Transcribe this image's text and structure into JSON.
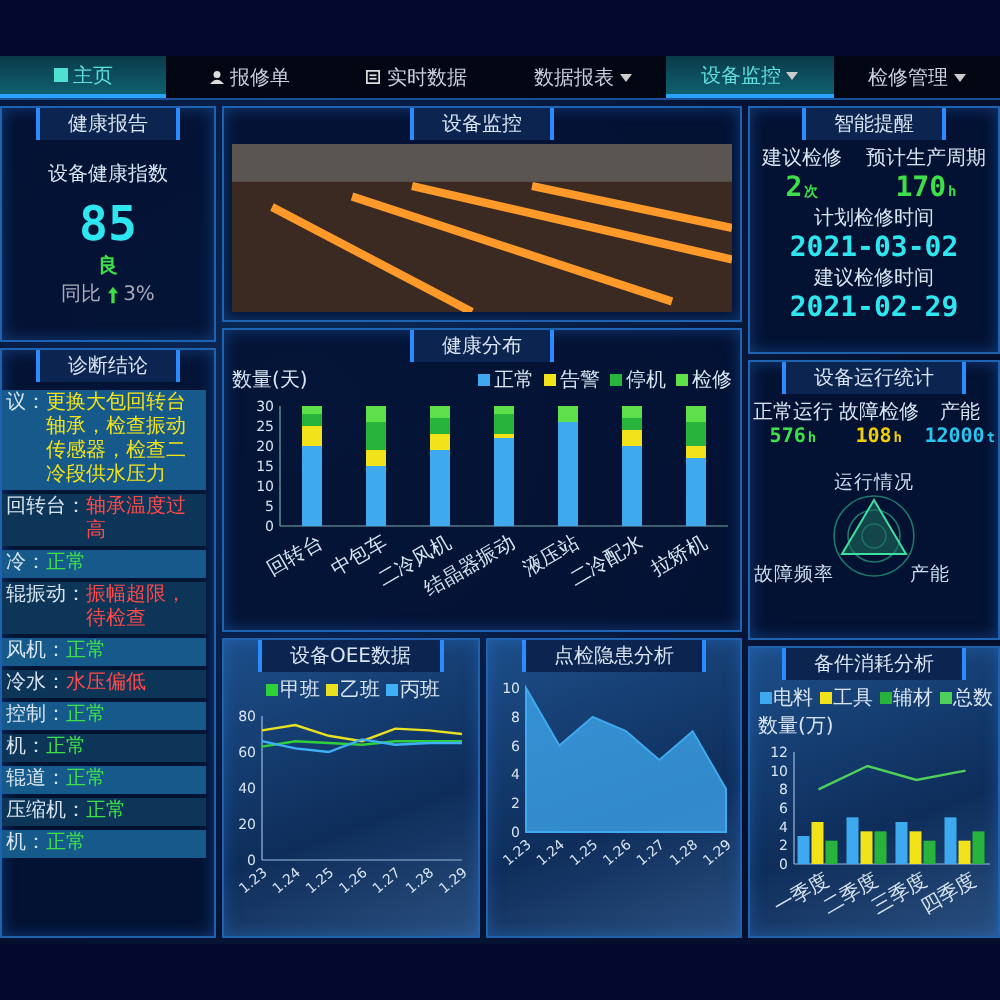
{
  "nav": {
    "tabs": [
      {
        "label": "主页",
        "kind": "grid",
        "selected": true
      },
      {
        "label": "报修单",
        "kind": "user",
        "selected": false
      },
      {
        "label": "实时数据",
        "kind": "doc",
        "selected": false
      },
      {
        "label": "数据报表",
        "kind": "dropdown",
        "selected": false
      },
      {
        "label": "设备监控",
        "kind": "dropdown",
        "selected": true
      },
      {
        "label": "检修管理",
        "kind": "dropdown",
        "selected": false
      }
    ]
  },
  "health_report": {
    "title": "健康报告",
    "index_label": "设备健康指数",
    "index_value": "85",
    "grade": "良",
    "yoy_label": "同比",
    "yoy_value": "3%"
  },
  "diagnosis": {
    "title": "诊断结论",
    "items": [
      {
        "label": "议：",
        "value": "更换大包回转台轴承，检查振动传感器，检查二冷段供水压力",
        "color": "#f2e21a"
      },
      {
        "label": "回转台：",
        "value": "轴承温度过高",
        "color": "#ff4a4a"
      },
      {
        "label": "冷：",
        "value": "正常",
        "color": "#3ee04a"
      },
      {
        "label": "辊振动：",
        "value": "振幅超限，待检查",
        "color": "#ff4a4a"
      },
      {
        "label": "风机：",
        "value": "正常",
        "color": "#3ee04a"
      },
      {
        "label": "冷水：",
        "value": "水压偏低",
        "color": "#ff4a4a"
      },
      {
        "label": "控制：",
        "value": "正常",
        "color": "#3ee04a"
      },
      {
        "label": "机：",
        "value": "正常",
        "color": "#3ee04a"
      },
      {
        "label": "辊道：",
        "value": "正常",
        "color": "#3ee04a"
      },
      {
        "label": "压缩机：",
        "value": "正常",
        "color": "#3ee04a"
      },
      {
        "label": "机：",
        "value": "正常",
        "color": "#3ee04a"
      }
    ]
  },
  "monitor": {
    "title": "设备监控"
  },
  "health_distribution": {
    "title": "健康分布",
    "chart_data": {
      "type": "bar",
      "stacked": true,
      "ylabel": "数量(天)",
      "categories": [
        "回转台",
        "中包车",
        "二冷风机",
        "结晶器振动",
        "液压站",
        "二冷配水",
        "拉矫机"
      ],
      "ylim": [
        0,
        30
      ],
      "yticks": [
        0,
        5,
        10,
        15,
        20,
        25,
        30
      ],
      "series": [
        {
          "name": "正常",
          "color": "#3fa9f0",
          "values": [
            20,
            15,
            19,
            22,
            26,
            20,
            17
          ]
        },
        {
          "name": "告警",
          "color": "#f2e21a",
          "values": [
            5,
            4,
            4,
            1,
            0,
            4,
            3
          ]
        },
        {
          "name": "停机",
          "color": "#27b33c",
          "values": [
            3,
            7,
            4,
            5,
            0,
            3,
            6
          ]
        },
        {
          "name": "检修",
          "color": "#5ee04a",
          "values": [
            2,
            4,
            3,
            2,
            4,
            3,
            4
          ]
        }
      ]
    }
  },
  "oee": {
    "title": "设备OEE数据",
    "chart_data": {
      "type": "line",
      "x": [
        "1.23",
        "1.24",
        "1.25",
        "1.26",
        "1.27",
        "1.28",
        "1.29"
      ],
      "ylim": [
        0,
        80
      ],
      "yticks": [
        0,
        20,
        40,
        60,
        80
      ],
      "series": [
        {
          "name": "甲班",
          "color": "#2fd03a",
          "values": [
            63,
            66,
            65,
            64,
            66,
            66,
            66
          ]
        },
        {
          "name": "乙班",
          "color": "#e8e020",
          "values": [
            72,
            75,
            69,
            66,
            73,
            72,
            70
          ]
        },
        {
          "name": "丙班",
          "color": "#3fb0f5",
          "values": [
            66,
            62,
            60,
            67,
            64,
            65,
            65
          ]
        }
      ]
    }
  },
  "inspection": {
    "title": "点检隐患分析",
    "chart_data": {
      "type": "area",
      "x": [
        "1.23",
        "1.24",
        "1.25",
        "1.26",
        "1.27",
        "1.28",
        "1.29"
      ],
      "ylim": [
        0,
        10
      ],
      "yticks": [
        0,
        2,
        4,
        6,
        8,
        10
      ],
      "series": [
        {
          "color": "#3fa9f0",
          "values": [
            10,
            6,
            8,
            7,
            5,
            7,
            3
          ]
        }
      ]
    }
  },
  "reminder": {
    "title": "智能提醒",
    "stats": [
      {
        "label": "建议检修",
        "value": "2",
        "unit": "次"
      },
      {
        "label": "预计生产周期",
        "value": "170",
        "unit": "h"
      }
    ],
    "dates": [
      {
        "label": "计划检修时间",
        "value": "2021-03-02"
      },
      {
        "label": "建议检修时间",
        "value": "2021-02-29"
      }
    ]
  },
  "running": {
    "title": "设备运行统计",
    "stats": [
      {
        "label": "正常运行",
        "value": "576",
        "unit": "h",
        "color": "#3ee04a"
      },
      {
        "label": "故障检修",
        "value": "108",
        "unit": "h",
        "color": "#f0d000"
      },
      {
        "label": "产能",
        "value": "12000",
        "unit": "t",
        "color": "#29c6f0"
      }
    ],
    "radar_labels": [
      "运行情况",
      "故障频率",
      "产能"
    ]
  },
  "spare": {
    "title": "备件消耗分析",
    "chart_data": {
      "type": "bar",
      "ylabel": "数量(万)",
      "categories": [
        "一季度",
        "二季度",
        "三季度",
        "四季度"
      ],
      "ylim": [
        0,
        12
      ],
      "yticks": [
        0,
        2,
        4,
        6,
        8,
        10,
        12
      ],
      "series": [
        {
          "name": "电料",
          "type": "bar",
          "color": "#3fa9f0",
          "values": [
            3,
            5,
            4.5,
            5
          ]
        },
        {
          "name": "工具",
          "type": "bar",
          "color": "#f2e21a",
          "values": [
            4.5,
            3.5,
            3.5,
            2.5
          ]
        },
        {
          "name": "辅材",
          "type": "bar",
          "color": "#27b33c",
          "values": [
            2.5,
            3.5,
            2.5,
            3.5
          ]
        },
        {
          "name": "总数",
          "type": "line",
          "color": "#4fd05a",
          "values": [
            8,
            10.5,
            9,
            10
          ]
        }
      ]
    }
  }
}
